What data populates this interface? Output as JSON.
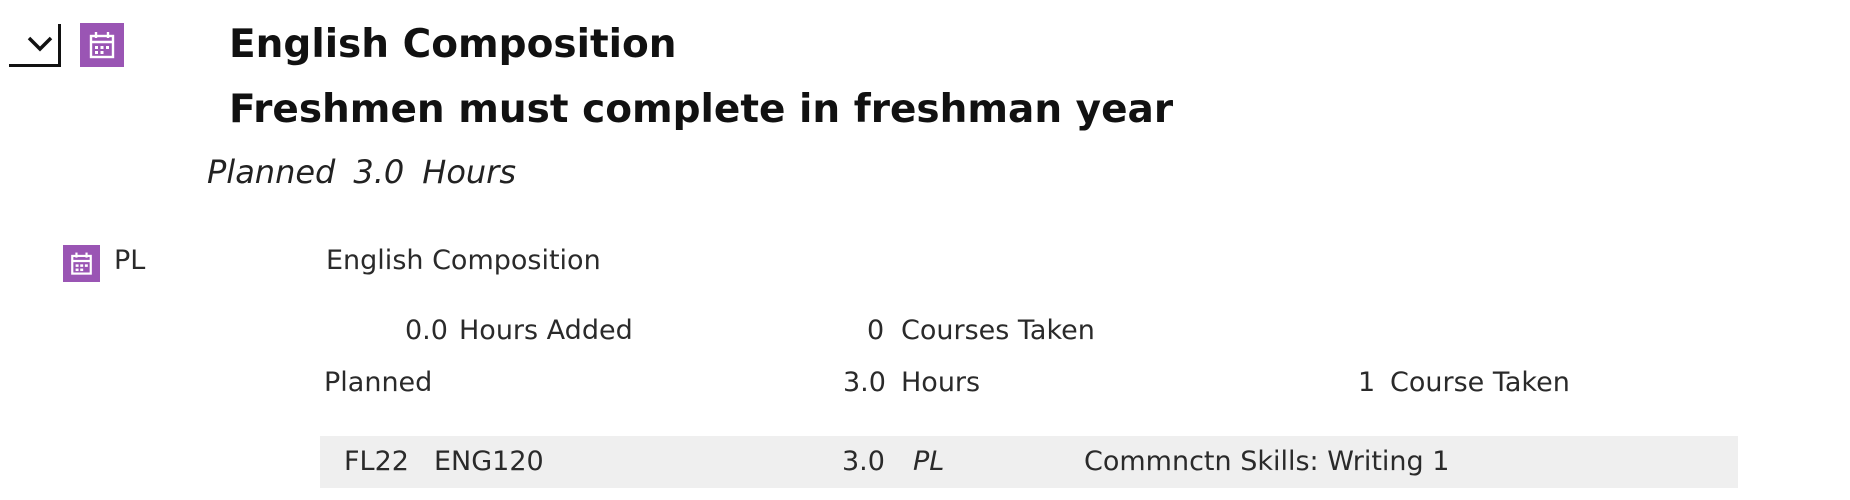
{
  "requirement": {
    "title": "English Composition",
    "subtitle": "Freshmen must complete in freshman year",
    "planned_label": "Planned",
    "planned_hours": "3.0",
    "hours_label": "Hours"
  },
  "rule": {
    "status": "PL",
    "name": "English Composition",
    "hours_added_value": "0.0",
    "hours_added_label": "Hours Added",
    "courses_taken_value": "0",
    "courses_taken_label": "Courses Taken",
    "planned_label": "Planned",
    "planned_hours_value": "3.0",
    "planned_hours_label": "Hours",
    "planned_count_value": "1",
    "planned_count_label": "Course Taken"
  },
  "courses": [
    {
      "term": "FL22",
      "code": "ENG120",
      "hours": "3.0",
      "grade": "PL",
      "title": "Commnctn Skills: Writing 1"
    }
  ],
  "colors": {
    "accent_purple": "#9a55b4",
    "row_background": "#efefef"
  },
  "icons": {
    "toggle": "chevron-down-icon",
    "status": "calendar-icon"
  }
}
